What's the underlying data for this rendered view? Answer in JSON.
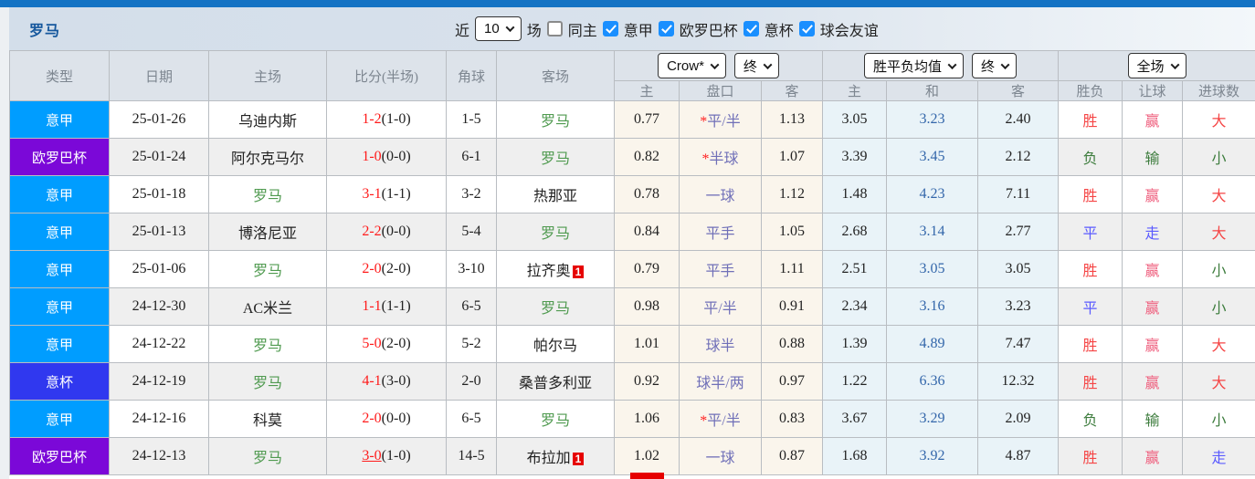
{
  "page": {
    "team_title": "罗马"
  },
  "filters": {
    "recent_label": "近",
    "matches_count": "10",
    "games_label": "场",
    "same_venue_label": "同主",
    "same_venue_class": "cb",
    "leagues": [
      {
        "label": "意甲",
        "state_class": "cb checked"
      },
      {
        "label": "欧罗巴杯",
        "state_class": "cb checked"
      },
      {
        "label": "意杯",
        "state_class": "cb checked"
      },
      {
        "label": "球会友谊",
        "state_class": "cb checked"
      }
    ]
  },
  "table": {
    "headers": {
      "type": "类型",
      "date": "日期",
      "home": "主场",
      "score": "比分(半场)",
      "corners": "角球",
      "away": "客场"
    },
    "selects": {
      "odds_company": "Crow*",
      "odds_time_1": "终",
      "avg_type": "胜平负均值",
      "odds_time_2": "终",
      "scope": "全场"
    },
    "sub_headers": [
      "主",
      "盘口",
      "客",
      "主",
      "和",
      "客",
      "胜负",
      "让球",
      "进球数"
    ],
    "rows": [
      {
        "type": "意甲",
        "type_class": "t-seriea",
        "date": "25-01-26",
        "home": "乌迪内斯",
        "home_class": "team",
        "ft": "1-2",
        "ft_class": "score-ft",
        "ht": "(1-0)",
        "corners": "1-5",
        "away": "罗马",
        "away_class": "team green",
        "away_badge": "",
        "crow_home": "0.77",
        "handicap_star": "*",
        "handicap": "平/半",
        "crow_away": "1.13",
        "avg_home": "3.05",
        "avg_draw": "3.23",
        "avg_away": "2.40",
        "wdl": "胜",
        "wdl_class": "res red",
        "letgoal": "赢",
        "letgoal_class": "res rose",
        "goals": "大",
        "goals_class": "res red"
      },
      {
        "type": "欧罗巴杯",
        "type_class": "t-europa",
        "date": "25-01-24",
        "home": "阿尔克马尔",
        "home_class": "team",
        "ft": "1-0",
        "ft_class": "score-ft",
        "ht": "(0-0)",
        "corners": "6-1",
        "away": "罗马",
        "away_class": "team green",
        "away_badge": "",
        "crow_home": "0.82",
        "handicap_star": "*",
        "handicap": "半球",
        "crow_away": "1.07",
        "avg_home": "3.39",
        "avg_draw": "3.45",
        "avg_away": "2.12",
        "wdl": "负",
        "wdl_class": "res green",
        "letgoal": "输",
        "letgoal_class": "res green",
        "goals": "小",
        "goals_class": "res green"
      },
      {
        "type": "意甲",
        "type_class": "t-seriea",
        "date": "25-01-18",
        "home": "罗马",
        "home_class": "team green",
        "ft": "3-1",
        "ft_class": "score-ft",
        "ht": "(1-1)",
        "corners": "3-2",
        "away": "热那亚",
        "away_class": "team",
        "away_badge": "",
        "crow_home": "0.78",
        "handicap_star": "",
        "handicap": "一球",
        "crow_away": "1.12",
        "avg_home": "1.48",
        "avg_draw": "4.23",
        "avg_away": "7.11",
        "wdl": "胜",
        "wdl_class": "res red",
        "letgoal": "赢",
        "letgoal_class": "res rose",
        "goals": "大",
        "goals_class": "res red"
      },
      {
        "type": "意甲",
        "type_class": "t-seriea",
        "date": "25-01-13",
        "home": "博洛尼亚",
        "home_class": "team",
        "ft": "2-2",
        "ft_class": "score-ft",
        "ht": "(0-0)",
        "corners": "5-4",
        "away": "罗马",
        "away_class": "team green",
        "away_badge": "",
        "crow_home": "0.84",
        "handicap_star": "",
        "handicap": "平手",
        "crow_away": "1.05",
        "avg_home": "2.68",
        "avg_draw": "3.14",
        "avg_away": "2.77",
        "wdl": "平",
        "wdl_class": "res blue",
        "letgoal": "走",
        "letgoal_class": "res blue",
        "goals": "大",
        "goals_class": "res red"
      },
      {
        "type": "意甲",
        "type_class": "t-seriea",
        "date": "25-01-06",
        "home": "罗马",
        "home_class": "team green",
        "ft": "2-0",
        "ft_class": "score-ft",
        "ht": "(2-0)",
        "corners": "3-10",
        "away": "拉齐奥",
        "away_class": "team",
        "away_badge": "1",
        "crow_home": "0.79",
        "handicap_star": "",
        "handicap": "平手",
        "crow_away": "1.11",
        "avg_home": "2.51",
        "avg_draw": "3.05",
        "avg_away": "3.05",
        "wdl": "胜",
        "wdl_class": "res red",
        "letgoal": "赢",
        "letgoal_class": "res rose",
        "goals": "小",
        "goals_class": "res green"
      },
      {
        "type": "意甲",
        "type_class": "t-seriea",
        "date": "24-12-30",
        "home": "AC米兰",
        "home_class": "team",
        "ft": "1-1",
        "ft_class": "score-ft",
        "ht": "(1-1)",
        "corners": "6-5",
        "away": "罗马",
        "away_class": "team green",
        "away_badge": "",
        "crow_home": "0.98",
        "handicap_star": "",
        "handicap": "平/半",
        "crow_away": "0.91",
        "avg_home": "2.34",
        "avg_draw": "3.16",
        "avg_away": "3.23",
        "wdl": "平",
        "wdl_class": "res blue",
        "letgoal": "赢",
        "letgoal_class": "res rose",
        "goals": "小",
        "goals_class": "res green"
      },
      {
        "type": "意甲",
        "type_class": "t-seriea",
        "date": "24-12-22",
        "home": "罗马",
        "home_class": "team green",
        "ft": "5-0",
        "ft_class": "score-ft",
        "ht": "(2-0)",
        "corners": "5-2",
        "away": "帕尔马",
        "away_class": "team",
        "away_badge": "",
        "crow_home": "1.01",
        "handicap_star": "",
        "handicap": "球半",
        "crow_away": "0.88",
        "avg_home": "1.39",
        "avg_draw": "4.89",
        "avg_away": "7.47",
        "wdl": "胜",
        "wdl_class": "res red",
        "letgoal": "赢",
        "letgoal_class": "res rose",
        "goals": "大",
        "goals_class": "res red"
      },
      {
        "type": "意杯",
        "type_class": "t-coppa",
        "date": "24-12-19",
        "home": "罗马",
        "home_class": "team green",
        "ft": "4-1",
        "ft_class": "score-ft",
        "ht": "(3-0)",
        "corners": "2-0",
        "away": "桑普多利亚",
        "away_class": "team",
        "away_badge": "",
        "crow_home": "0.92",
        "handicap_star": "",
        "handicap": "球半/两",
        "crow_away": "0.97",
        "avg_home": "1.22",
        "avg_draw": "6.36",
        "avg_away": "12.32",
        "wdl": "胜",
        "wdl_class": "res red",
        "letgoal": "赢",
        "letgoal_class": "res rose",
        "goals": "大",
        "goals_class": "res red"
      },
      {
        "type": "意甲",
        "type_class": "t-seriea",
        "date": "24-12-16",
        "home": "科莫",
        "home_class": "team",
        "ft": "2-0",
        "ft_class": "score-ft",
        "ht": "(0-0)",
        "corners": "6-5",
        "away": "罗马",
        "away_class": "team green",
        "away_badge": "",
        "crow_home": "1.06",
        "handicap_star": "*",
        "handicap": "平/半",
        "crow_away": "0.83",
        "avg_home": "3.67",
        "avg_draw": "3.29",
        "avg_away": "2.09",
        "wdl": "负",
        "wdl_class": "res green",
        "letgoal": "输",
        "letgoal_class": "res green",
        "goals": "小",
        "goals_class": "res green"
      },
      {
        "type": "欧罗巴杯",
        "type_class": "t-europa",
        "date": "24-12-13",
        "home": "罗马",
        "home_class": "team green",
        "ft": "3-0",
        "ft_class": "score-ft ul",
        "ht": "(1-0)",
        "corners": "14-5",
        "away": "布拉加",
        "away_class": "team",
        "away_badge": "1",
        "crow_home": "1.02",
        "handicap_star": "",
        "handicap": "一球",
        "crow_away": "0.87",
        "avg_home": "1.68",
        "avg_draw": "3.92",
        "avg_away": "4.87",
        "wdl": "胜",
        "wdl_class": "res red",
        "letgoal": "赢",
        "letgoal_class": "res rose",
        "goals": "走",
        "goals_class": "res blue"
      }
    ]
  },
  "colors": {
    "topbar": "#1473c4",
    "seriea": "#009dff",
    "europa_league": "#7b08d8",
    "coppa_italia": "#3038ef",
    "team_green": "#4f9a4f",
    "score_red": "#ff1a1a",
    "win_red": "#f54545",
    "lose_green": "#3e7d3e",
    "draw_blue": "#5b5bff",
    "odds_cream_bg": "#faf5ec",
    "avg_blue_bg": "#e9f3f8"
  }
}
